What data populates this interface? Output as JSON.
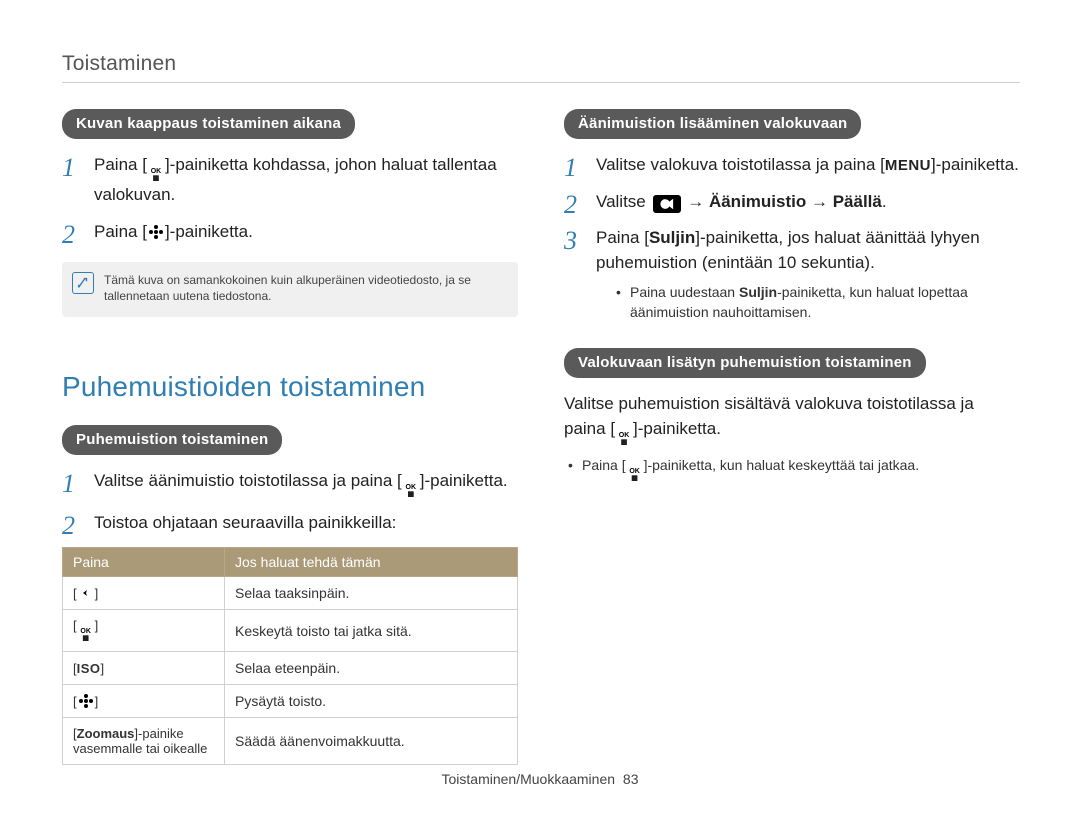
{
  "header": {
    "title": "Toistaminen"
  },
  "section_main": {
    "title": "Puhemuistioiden toistaminen"
  },
  "pills": {
    "capture": "Kuvan kaappaus toistaminen aikana",
    "playmemo": "Puhemuistion toistaminen",
    "addvoice": "Äänimuistion lisääminen valokuvaan",
    "playadded": "Valokuvaan lisätyn puhemuistion toistaminen"
  },
  "left": {
    "step1_a": "Paina [",
    "step1_b": "]-painiketta kohdassa, johon haluat tallentaa valokuvan.",
    "step2_a": "Paina [",
    "step2_b": "]-painiketta.",
    "note": "Tämä kuva on samankokoinen kuin alkuperäinen videotiedosto, ja se tallennetaan uutena tiedostona.",
    "memo_step1_a": "Valitse äänimuistio toistotilassa ja paina [",
    "memo_step1_b": "]-painiketta.",
    "memo_step2": "Toistoa ohjataan seuraavilla painikkeilla:"
  },
  "table": {
    "h1": "Paina",
    "h2": "Jos haluat tehdä tämän",
    "rows": [
      {
        "key_pre": "[",
        "key_icon": "left",
        "key_post": "]",
        "val": "Selaa taaksinpäin."
      },
      {
        "key_pre": "[",
        "key_icon": "ok",
        "key_post": "]",
        "val": "Keskeytä toisto tai jatka sitä."
      },
      {
        "key_pre": "[",
        "key_icon": "iso",
        "key_post": "]",
        "val": "Selaa eteenpäin."
      },
      {
        "key_pre": "[",
        "key_icon": "flower",
        "key_post": "]",
        "val": "Pysäytä toisto."
      },
      {
        "key_text": "[Zoomaus]-painike vasemmalle tai oikealle",
        "val": "Säädä äänenvoimakkuutta."
      }
    ]
  },
  "right": {
    "step1_a": "Valitse valokuva toistotilassa ja paina [",
    "step1_b": "]-painiketta.",
    "step2_a": "Valitse ",
    "step2_b": " → ",
    "step2_c": "Äänimuistio",
    "step2_d": " → ",
    "step2_e": "Päällä",
    "step2_f": ".",
    "step3_a": "Paina [",
    "step3_b": "Suljin",
    "step3_c": "]-painiketta, jos haluat äänittää lyhyen puhemuistion (enintään 10 sekuntia).",
    "bullet1_a": "Paina uudestaan ",
    "bullet1_b": "Suljin",
    "bullet1_c": "-painiketta, kun haluat lopettaa äänimuistion nauhoittamisen.",
    "play_body_a": "Valitse puhemuistion sisältävä valokuva toistotilassa ja paina [",
    "play_body_b": "]-painiketta.",
    "play_bullet_a": "Paina [",
    "play_bullet_b": "]-painiketta, kun haluat keskeyttää tai jatkaa."
  },
  "footer": {
    "label": "Toistaminen/Muokkaaminen",
    "page": "83"
  },
  "icons": {
    "menu_label": "MENU",
    "iso_label": "ISO",
    "ok_top": "OK",
    "ok_bot": "☐",
    "zoom_label": "Zoomaus"
  }
}
